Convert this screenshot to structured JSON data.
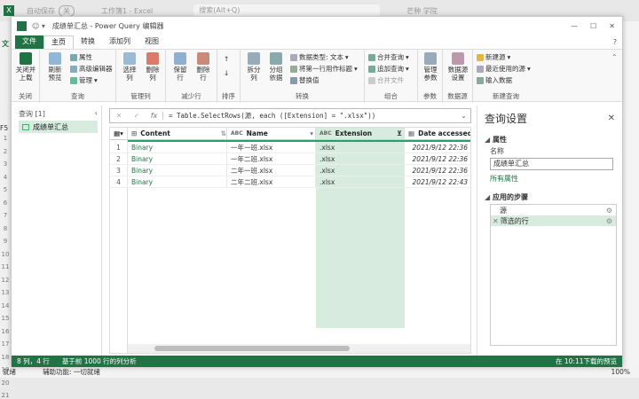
{
  "excel": {
    "autosave": "自动保存",
    "autosave_state": "关",
    "filename": "工作簿1 - Excel",
    "search_placeholder": "搜索(Alt+Q)",
    "user": "芒种 学院",
    "file_tab": "文",
    "cell_ref": "F5",
    "status_ready": "就绪",
    "accessibility": "辅助功能: 一切就绪",
    "zoom": "100%",
    "row_headers": [
      "1",
      "2",
      "3",
      "4",
      "5",
      "6",
      "7",
      "8",
      "9",
      "10",
      "11",
      "12",
      "13",
      "14",
      "15",
      "16",
      "17",
      "18",
      "19",
      "20",
      "21"
    ]
  },
  "pq": {
    "title": "成绩单汇总 - Power Query 编辑器",
    "tabs": [
      "文件",
      "主页",
      "转换",
      "添加列",
      "视图"
    ],
    "ribbon": {
      "groups": [
        {
          "label": "关闭",
          "buttons": [
            "关闭并\n上载"
          ]
        },
        {
          "label": "查询",
          "buttons": [
            "刷新\n预览"
          ],
          "small": [
            "属性",
            "高级编辑器",
            "管理"
          ]
        },
        {
          "label": "管理列",
          "buttons": [
            "选择\n列",
            "删除\n列"
          ]
        },
        {
          "label": "减少行",
          "buttons": [
            "保留\n行",
            "删除\n行"
          ]
        },
        {
          "label": "排序",
          "buttons": []
        },
        {
          "label": "转换",
          "buttons": [
            "拆分\n列",
            "分组\n依据"
          ],
          "small": [
            "数据类型: 文本",
            "将第一行用作标题",
            "替换值"
          ]
        },
        {
          "label": "组合",
          "small": [
            "合并查询",
            "追加查询",
            "合并文件"
          ]
        },
        {
          "label": "参数",
          "buttons": [
            "管理\n参数"
          ]
        },
        {
          "label": "数据源",
          "buttons": [
            "数据源\n设置"
          ]
        },
        {
          "label": "新建查询",
          "small": [
            "新建源",
            "最近使用的源",
            "输入数据"
          ]
        }
      ]
    },
    "queries": {
      "header": "查询 [1]",
      "items": [
        "成绩单汇总"
      ]
    },
    "formula": "= Table.SelectRows(源, each ([Extension] = \".xlsx\"))",
    "formula_fx": "fx",
    "columns": [
      "Content",
      "Name",
      "Extension",
      "Date accessed"
    ],
    "col_type_icons": [
      "⊞",
      "ABC",
      "ABC",
      "▦"
    ],
    "rows": [
      [
        "1",
        "Binary",
        "一年一班.xlsx",
        ".xlsx",
        "2021/9/12 22:36"
      ],
      [
        "2",
        "Binary",
        "一年二班.xlsx",
        ".xlsx",
        "2021/9/12 22:36"
      ],
      [
        "3",
        "Binary",
        "二年一班.xlsx",
        ".xlsx",
        "2021/9/12 22:36"
      ],
      [
        "4",
        "Binary",
        "二年二班.xlsx",
        ".xlsx",
        "2021/9/12 22:43"
      ]
    ],
    "settings": {
      "title": "查询设置",
      "props_header": "属性",
      "name_label": "名称",
      "name_value": "成绩单汇总",
      "all_props": "所有属性",
      "steps_header": "应用的步骤",
      "steps": [
        "源",
        "筛选的行"
      ]
    },
    "status_left": "8 列，4 行",
    "status_mid": "基于前 1000 行的列分析",
    "status_right": "在 10:11下载的预览",
    "colors": {
      "accent": "#217346",
      "selected": "#d7ecdf"
    }
  }
}
